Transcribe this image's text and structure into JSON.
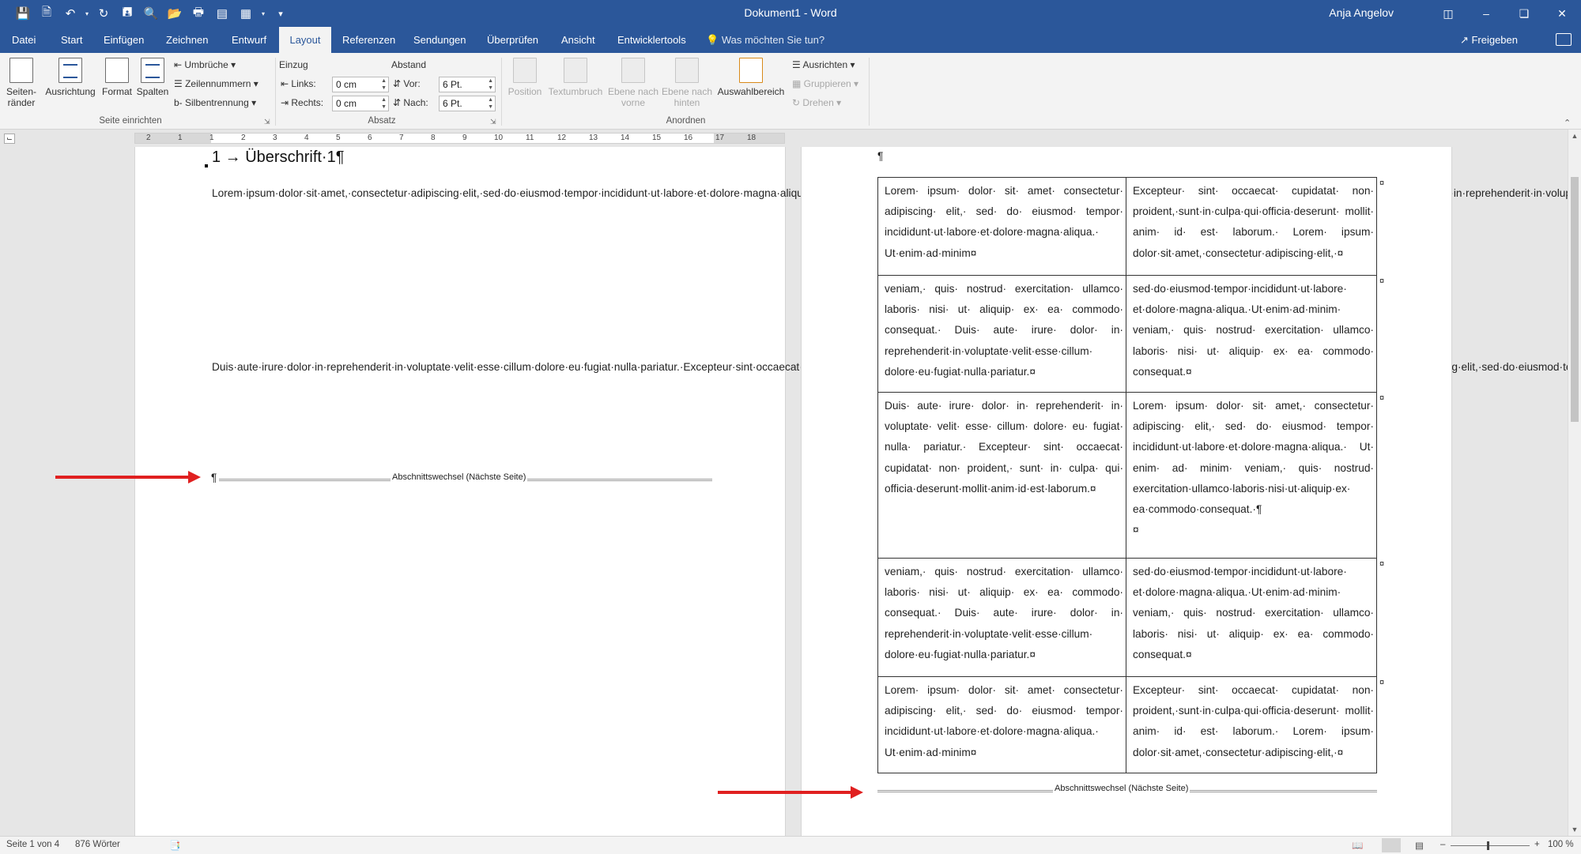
{
  "window": {
    "title": "Dokument1  -  Word",
    "user": "Anja Angelov"
  },
  "quick_access": [
    "save-icon",
    "new-document-icon",
    "undo-icon",
    "redo-icon",
    "save-as-icon",
    "print-preview-icon",
    "open-icon",
    "print-icon",
    "layout-icon",
    "table-icon",
    "customize-icon"
  ],
  "tabs": [
    "Datei",
    "Start",
    "Einfügen",
    "Zeichnen",
    "Entwurf",
    "Layout",
    "Referenzen",
    "Sendungen",
    "Überprüfen",
    "Ansicht",
    "Entwicklertools"
  ],
  "active_tab": "Layout",
  "tell_me": "Was möchten Sie tun?",
  "share": "Freigeben",
  "ribbon": {
    "seite_einrichten": {
      "label": "Seite einrichten",
      "margins": "Seiten-\nränder",
      "orientation": "Ausrichtung",
      "format": "Format",
      "columns": "Spalten",
      "breaks": "Umbrüche",
      "line_numbers": "Zeilennummern",
      "hyphenation": "Silbentrennung"
    },
    "absatz": {
      "label": "Absatz",
      "indent_title": "Einzug",
      "spacing_title": "Abstand",
      "left_label": "Links:",
      "left_value": "0 cm",
      "right_label": "Rechts:",
      "right_value": "0 cm",
      "before_label": "Vor:",
      "before_value": "6 Pt.",
      "after_label": "Nach:",
      "after_value": "6 Pt."
    },
    "anordnen": {
      "label": "Anordnen",
      "position": "Position",
      "wrap_text": "Textumbruch",
      "bring_forward": "Ebene nach\nvorne",
      "send_backward": "Ebene nach\nhinten",
      "selection_pane": "Auswahlbereich",
      "align": "Ausrichten",
      "group": "Gruppieren",
      "rotate": "Drehen"
    }
  },
  "ruler_ticks": [
    "2",
    "1",
    "1",
    "2",
    "3",
    "4",
    "5",
    "6",
    "7",
    "8",
    "9",
    "10",
    "11",
    "12",
    "13",
    "14",
    "15",
    "16",
    "17",
    "18"
  ],
  "document": {
    "page1": {
      "heading": "1 → Überschrift·1¶",
      "paragraphs": [
        "Lorem·ipsum·dolor·sit·amet,·consectetur·adipiscing·elit,·sed·do·eiusmod·tempor·incididunt·ut·labore·et·dolore·magna·aliqua.·Ut·enim·ad·minim·veniam,·quis·nostrud·exercitation·ullamco·laboris·nisi·ut·aliquip·ex·ea·commodo·consequat.·Duis·aute·irure·dolor·in·reprehenderit·in·voluptate·velit·esse·cillum·dolore·eu·fugiat·nulla·pariatur.·Excepteur·sint·occaecat·cupidatat·non·proident,·sunt·in·culpa·qui·officia·deserunt·mollit·anim·id·est·laborum.·Lorem·ipsum·dolor·sit·amet,·consectetur·adipiscing·elit,·sed·do·eiusmod·tempor·incididunt·ut·labore·et·dolore·magna·aliqua.·Ut·enim·ad·minim·veniam,·quis·nostrud·exercitation·ullamco·laboris·nisi·ut·aliquip·ex·ea·commodo·consequat.·¶",
        "Duis·aute·irure·dolor·in·reprehenderit·in·voluptate·velit·esse·cillum·dolore·eu·fugiat·nulla·pariatur.·Excepteur·sint·occaecat·cupidatat·non·proident,·sunt·in·culpa·qui·officia·deserunt·mollit·anim·id·est·laborum.·Lorem·ipsum·dolor·sit·amet,·consectetur·adipiscing·elit,·sed·do·eiusmod·tempor·incididunt·ut·labore·et·dolore·magna·aliqua.·Ut·enim·ad·minim·veniam,·quis·nostrud·exercitation·ullamco·laboris·nisi·ut·aliquip·ex·ea·commodo·consequat.·¶"
      ],
      "break_pilcrow": "¶",
      "section_break": "Abschnittswechsel (Nächste Seite)"
    },
    "page2": {
      "pilcrow": "¶",
      "table": [
        [
          "Lorem· ipsum· dolor· sit· amet· consectetur· adipiscing· elit,· sed· do· eiusmod· tempor· incididunt·ut·labore·et·dolore·magna·aliqua.· Ut·enim·ad·minim¤",
          "Excepteur· sint· occaecat· cupidatat· non· proident,·sunt·in·culpa·qui·officia·deserunt· mollit· anim· id· est· laborum.· Lorem· ipsum· dolor·sit·amet,·consectetur·adipiscing·elit,·¤"
        ],
        [
          "veniam,· quis· nostrud· exercitation· ullamco· laboris· nisi· ut· aliquip· ex· ea· commodo· consequat.· Duis· aute· irure· dolor· in· reprehenderit·in·voluptate·velit·esse·cillum· dolore·eu·fugiat·nulla·pariatur.¤",
          "sed·do·eiusmod·tempor·incididunt·ut·labore· et·dolore·magna·aliqua.·Ut·enim·ad·minim· veniam,· quis· nostrud· exercitation· ullamco· laboris· nisi· ut· aliquip· ex· ea· commodo· consequat.¤"
        ],
        [
          "Duis· aute· irure· dolor· in· reprehenderit· in· voluptate· velit· esse· cillum· dolore· eu· fugiat· nulla· pariatur.· Excepteur· sint· occaecat· cupidatat· non· proident,· sunt· in· culpa· qui· officia·deserunt·mollit·anim·id·est·laborum.¤",
          "Lorem· ipsum· dolor· sit· amet,· consectetur· adipiscing· elit,· sed· do· eiusmod· tempor· incididunt·ut·labore·et·dolore·magna·aliqua.· Ut· enim· ad· minim· veniam,· quis· nostrud· exercitation·ullamco·laboris·nisi·ut·aliquip·ex· ea·commodo·consequat.·¶\n¤"
        ],
        [
          "veniam,· quis· nostrud· exercitation· ullamco· laboris· nisi· ut· aliquip· ex· ea· commodo· consequat.· Duis· aute· irure· dolor· in· reprehenderit·in·voluptate·velit·esse·cillum· dolore·eu·fugiat·nulla·pariatur.¤",
          "sed·do·eiusmod·tempor·incididunt·ut·labore· et·dolore·magna·aliqua.·Ut·enim·ad·minim· veniam,· quis· nostrud· exercitation· ullamco· laboris· nisi· ut· aliquip· ex· ea· commodo· consequat.¤"
        ],
        [
          "Lorem· ipsum· dolor· sit· amet· consectetur· adipiscing· elit,· sed· do· eiusmod· tempor· incididunt·ut·labore·et·dolore·magna·aliqua.· Ut·enim·ad·minim¤",
          "Excepteur· sint· occaecat· cupidatat· non· proident,·sunt·in·culpa·qui·officia·deserunt· mollit· anim· id· est· laborum.· Lorem· ipsum· dolor·sit·amet,·consectetur·adipiscing·elit,·¤"
        ]
      ],
      "row_end_mark": "¤",
      "section_break": "Abschnittswechsel (Nächste Seite)"
    }
  },
  "annotation_color": "#e02020",
  "status": {
    "page": "Seite 1 von 4",
    "words": "876 Wörter",
    "zoom_minus": "–",
    "zoom_plus": "+",
    "zoom": "100 %"
  }
}
